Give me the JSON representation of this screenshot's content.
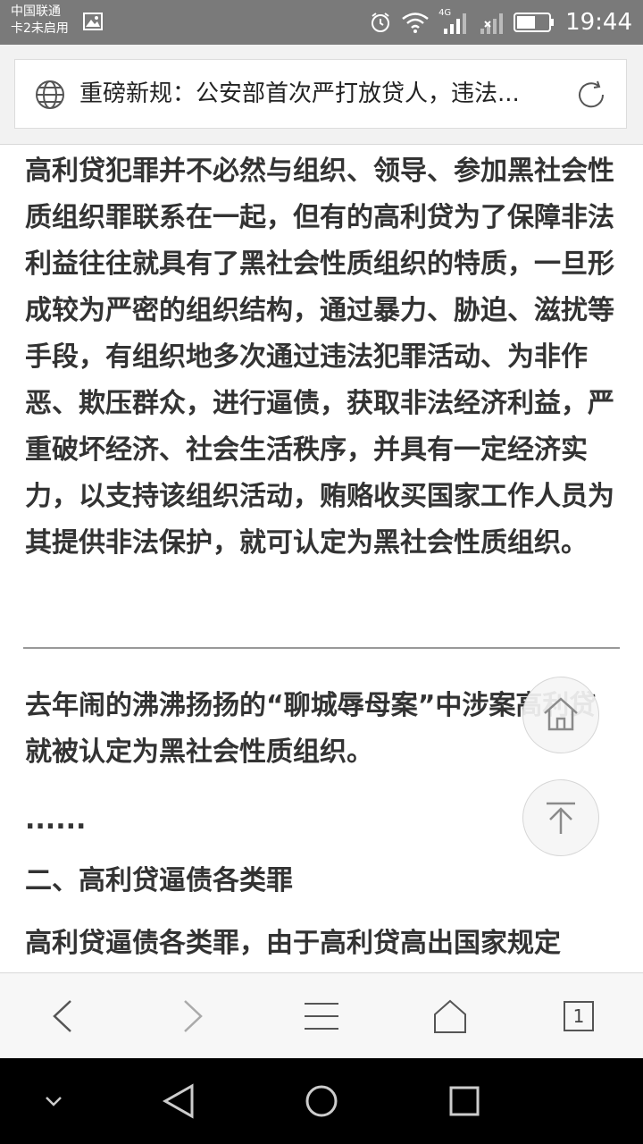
{
  "status_bar": {
    "carrier_primary": "中国联通",
    "carrier_secondary": "卡2未启用",
    "network_type": "4G",
    "time": "19:44"
  },
  "address_bar": {
    "title": "重磅新规：公安部首次严打放贷人，违法...",
    "icons": [
      "globe-icon",
      "refresh-icon"
    ]
  },
  "article": {
    "paragraph1": "高利贷犯罪并不必然与组织、领导、参加黑社会性质组织罪联系在一起，但有的高利贷为了保障非法利益往往就具有了黑社会性质组织的特质，一旦形成较为严密的组织结构，通过暴力、胁迫、滋扰等手段，有组织地多次通过违法犯罪活动、为非作恶、欺压群众，进行逼债，获取非法经济利益，严重破坏经济、社会生活秩序，并具有一定经济实力，以支持该组织活动，贿赂收买国家工作人员为其提供非法保护，就可认定为黑社会性质组织。",
    "paragraph2": "去年闹的沸沸扬扬的“聊城辱母案”中涉案高利贷就被认定为黑社会性质组织。",
    "ellipsis": "......",
    "heading": "二、高利贷逼债各类罪",
    "paragraph3": "高利贷逼债各类罪，由于高利贷高出国家规定"
  },
  "floating_buttons": [
    "home-icon",
    "back-to-top-icon"
  ],
  "toolbar": {
    "tab_count": "1",
    "icons": [
      "back-arrow-icon",
      "forward-arrow-icon",
      "menu-icon",
      "home-icon",
      "tabs-icon"
    ]
  },
  "colors": {
    "status_bar_bg": "#7a7a7a",
    "text": "#333333",
    "toolbar_bg": "#f7f7f7",
    "navbar_bg": "#000000"
  }
}
